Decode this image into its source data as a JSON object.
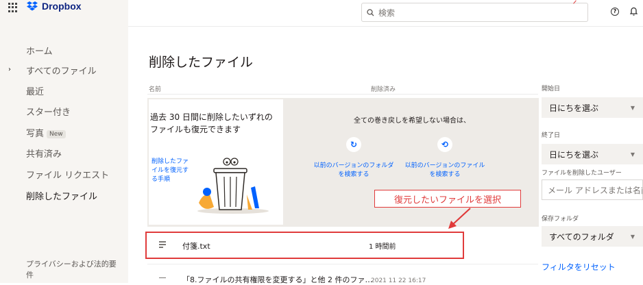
{
  "header": {
    "brand": "Dropbox",
    "search_placeholder": "検索"
  },
  "sidebar": {
    "items": [
      {
        "label": "ホーム"
      },
      {
        "label": "すべてのファイル"
      },
      {
        "label": "最近"
      },
      {
        "label": "スター付き"
      },
      {
        "label": "写真",
        "badge": "New"
      },
      {
        "label": "共有済み"
      },
      {
        "label": "ファイル リクエスト"
      },
      {
        "label": "削除したファイル"
      }
    ],
    "privacy": "プライバシーおよび法的要件"
  },
  "main": {
    "title": "削除したファイル",
    "columns": {
      "name": "名前",
      "deleted": "削除済み"
    },
    "banner": {
      "card_text": "過去 30 日間に削除したいずれのファイルも復元できます",
      "card_link": "削除したファイルを復元する手順",
      "message": "全ての巻き戻しを希望しない場合は、",
      "option1": "以前のバージョンのフォルダを検索する",
      "option2": "以前のバージョンのファイルを検索する"
    },
    "rows": [
      {
        "name": "付箋.txt",
        "deleted": "1 時間前"
      },
      {
        "name": "「8.ファイルの共有権限を変更する」と他 2 件のファ…",
        "deleted": "2021 11 22 16:17"
      }
    ]
  },
  "annotation": {
    "label": "復元したいファイルを選択"
  },
  "filters": {
    "start_label": "開始日",
    "start_value": "日にちを選ぶ",
    "end_label": "終了日",
    "end_value": "日にちを選ぶ",
    "user_label": "ファイルを削除したユーザー",
    "user_placeholder": "メール アドレスまたは名前",
    "folder_label": "保存フォルダ",
    "folder_value": "すべてのフォルダ",
    "reset": "フィルタをリセット"
  },
  "colors": {
    "brand_blue": "#0061fe",
    "highlight_red": "#e03a3a"
  }
}
